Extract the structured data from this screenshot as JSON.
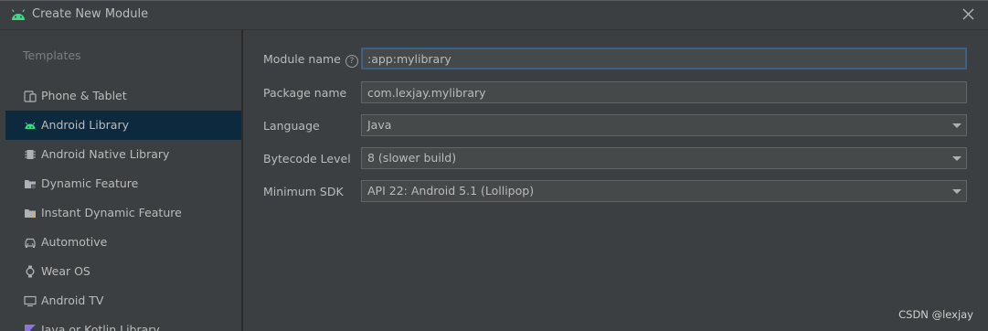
{
  "window": {
    "title": "Create New Module"
  },
  "sidebar": {
    "header": "Templates",
    "items": [
      {
        "label": "Phone & Tablet",
        "icon": "phone-tablet-icon",
        "selected": false
      },
      {
        "label": "Android Library",
        "icon": "android-icon",
        "selected": true
      },
      {
        "label": "Android Native Library",
        "icon": "chip-icon",
        "selected": false
      },
      {
        "label": "Dynamic Feature",
        "icon": "folder-module-icon",
        "selected": false
      },
      {
        "label": "Instant Dynamic Feature",
        "icon": "folder-instant-icon",
        "selected": false
      },
      {
        "label": "Automotive",
        "icon": "car-icon",
        "selected": false
      },
      {
        "label": "Wear OS",
        "icon": "watch-icon",
        "selected": false
      },
      {
        "label": "Android TV",
        "icon": "tv-icon",
        "selected": false
      },
      {
        "label": "Java or Kotlin Library",
        "icon": "kotlin-icon",
        "selected": false
      }
    ]
  },
  "form": {
    "module_name": {
      "label": "Module name",
      "value": ":app:mylibrary"
    },
    "package_name": {
      "label": "Package name",
      "value": "com.lexjay.mylibrary"
    },
    "language": {
      "label": "Language",
      "value": "Java"
    },
    "bytecode_level": {
      "label": "Bytecode Level",
      "value": "8 (slower build)"
    },
    "minimum_sdk": {
      "label": "Minimum SDK",
      "value": "API 22: Android 5.1 (Lollipop)"
    }
  },
  "watermark": "CSDN @lexjay",
  "colors": {
    "background": "#3c3f41",
    "selected_item": "#0d293e",
    "focus_border": "#3d6185",
    "android_green": "#3ddc84"
  }
}
